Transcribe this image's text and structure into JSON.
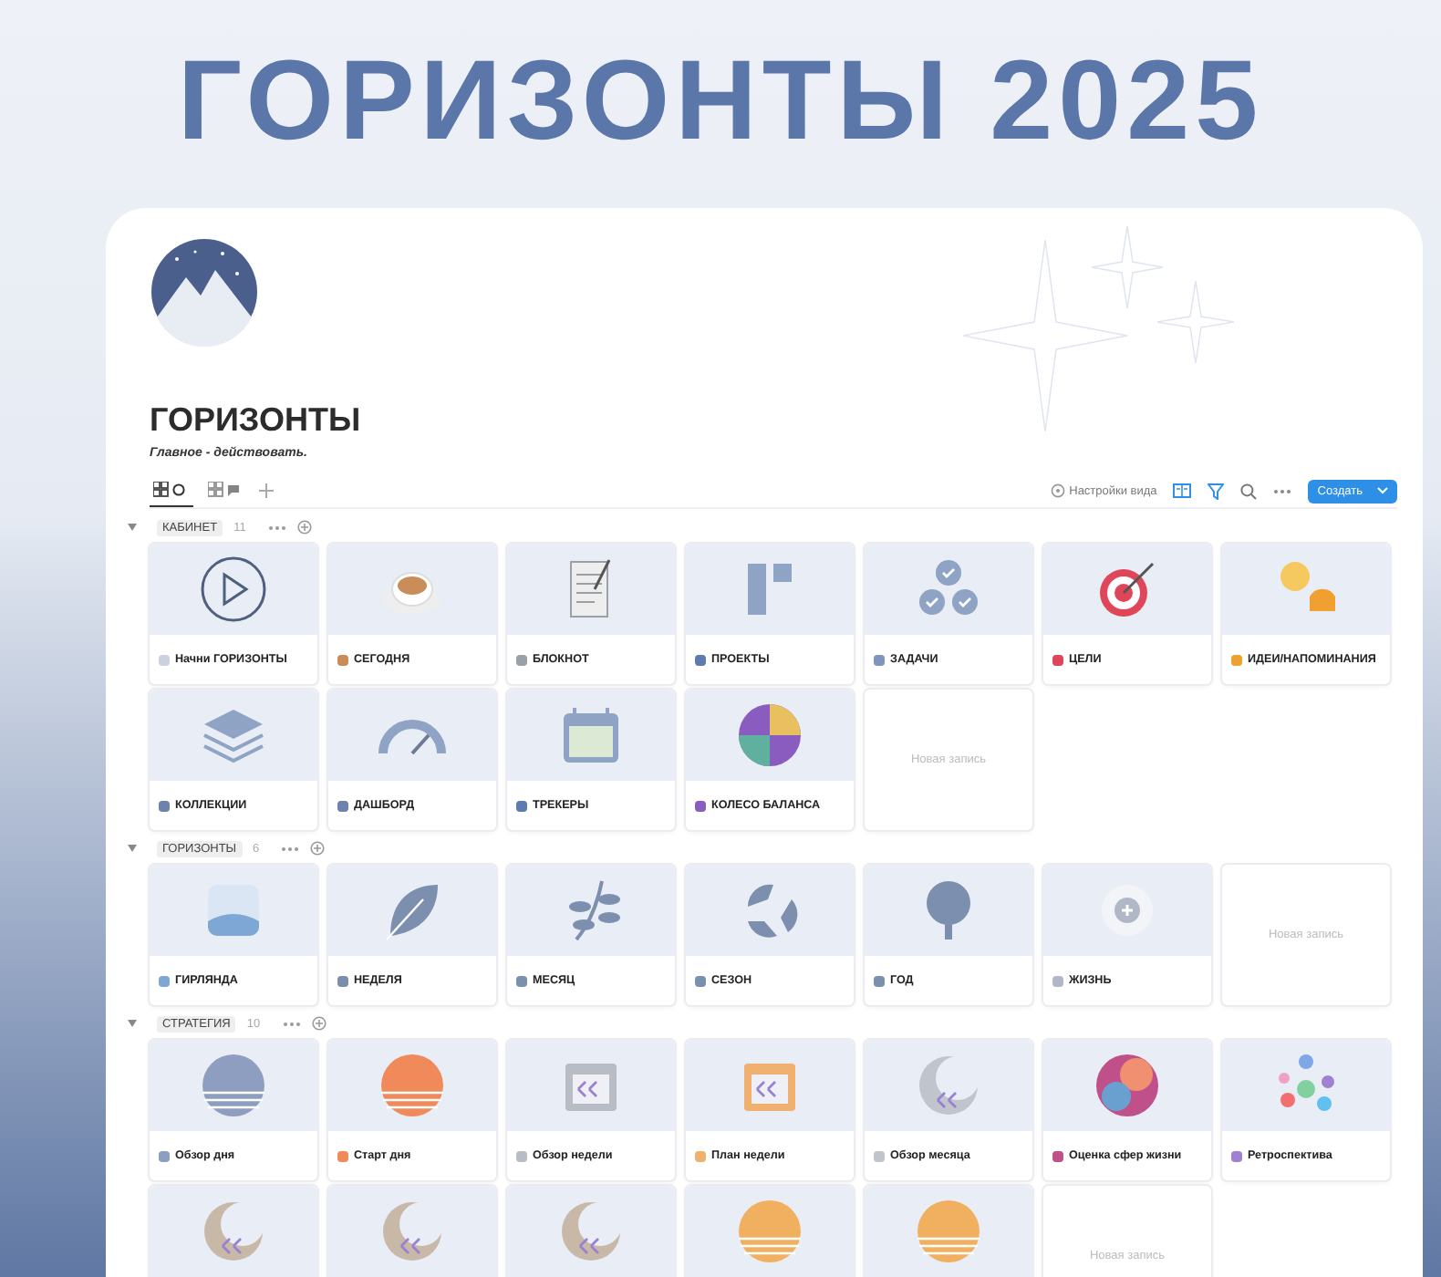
{
  "headline": "ГОРИЗОНТЫ 2025",
  "page": {
    "title": "ГОРИЗОНТЫ",
    "subtitle": "Главное - действовать."
  },
  "tabs": [
    {
      "kind": "circle",
      "selected": true
    },
    {
      "kind": "chat",
      "selected": false
    }
  ],
  "toolbar": {
    "view_settings": "Настройки вида",
    "create_button": "Создать"
  },
  "sections": [
    {
      "name": "КАБИНЕТ",
      "count": "11",
      "expanded": true,
      "cards": [
        {
          "kind": "play",
          "label": "Начни ГОРИЗОНТЫ",
          "color": "#c9d2e0"
        },
        {
          "kind": "cup",
          "label": "СЕГОДНЯ",
          "color": "#c98d5a"
        },
        {
          "kind": "notepad",
          "label": "БЛОКНОТ",
          "color": "#9aa0a8"
        },
        {
          "kind": "board",
          "label": "ПРОЕКТЫ",
          "color": "#5d7bb0"
        },
        {
          "kind": "checks",
          "label": "ЗАДАЧИ",
          "color": "#7f95bd"
        },
        {
          "kind": "target",
          "label": "ЦЕЛИ",
          "color": "#e0465a"
        },
        {
          "kind": "bulb",
          "label": "ИДЕИ/НАПОМИНАНИЯ",
          "color": "#f0a030"
        },
        {
          "kind": "layers",
          "label": "КОЛЛЕКЦИИ",
          "color": "#6d83ad"
        },
        {
          "kind": "gauge",
          "label": "ДАШБОРД",
          "color": "#6d83ad"
        },
        {
          "kind": "calendar",
          "label": "ТРЕКЕРЫ",
          "color": "#5d7bb0"
        },
        {
          "kind": "wheel",
          "label": "КОЛЕСО БАЛАНСА",
          "color": "#8a5cc0"
        },
        {
          "kind": "new",
          "label": "Новая запись"
        }
      ]
    },
    {
      "name": "ГОРИЗОНТЫ",
      "count": "6",
      "expanded": true,
      "cards": [
        {
          "kind": "photo",
          "label": "ГИРЛЯНДА",
          "color": "#7fa7d6"
        },
        {
          "kind": "leaf",
          "label": "НЕДЕЛЯ",
          "color": "#7d8fae"
        },
        {
          "kind": "branch",
          "label": "МЕСЯЦ",
          "color": "#7d8fae"
        },
        {
          "kind": "recycle",
          "label": "СЕЗОН",
          "color": "#7d8fae"
        },
        {
          "kind": "tree",
          "label": "ГОД",
          "color": "#7d8fae"
        },
        {
          "kind": "sun",
          "label": "ЖИЗНЬ",
          "color": "#b0b8c8"
        },
        {
          "kind": "new",
          "label": "Новая запись"
        }
      ]
    },
    {
      "name": "СТРАТЕГИЯ",
      "count": "10",
      "expanded": true,
      "cards": [
        {
          "kind": "sunset",
          "label": "Обзор дня",
          "color": "#8e9ec0"
        },
        {
          "kind": "sunrise",
          "label": "Старт дня",
          "color": "#f08a5a"
        },
        {
          "kind": "cal-arrows",
          "label": "Обзор недели",
          "color": "#b8bcc4"
        },
        {
          "kind": "cal-arrows",
          "label": "План недели",
          "color": "#f0b070"
        },
        {
          "kind": "moon",
          "label": "Обзор месяца",
          "color": "#c0c4cc"
        },
        {
          "kind": "gradient",
          "label": "Оценка сфер жизни",
          "color": "#c0508a"
        },
        {
          "kind": "dots",
          "label": "Ретроспектива",
          "color": "#a080d0"
        },
        {
          "kind": "moon"
        },
        {
          "kind": "moon"
        },
        {
          "kind": "moon"
        },
        {
          "kind": "sunrise"
        },
        {
          "kind": "sunrise"
        },
        {
          "kind": "new",
          "label": "Новая запись"
        }
      ]
    }
  ]
}
